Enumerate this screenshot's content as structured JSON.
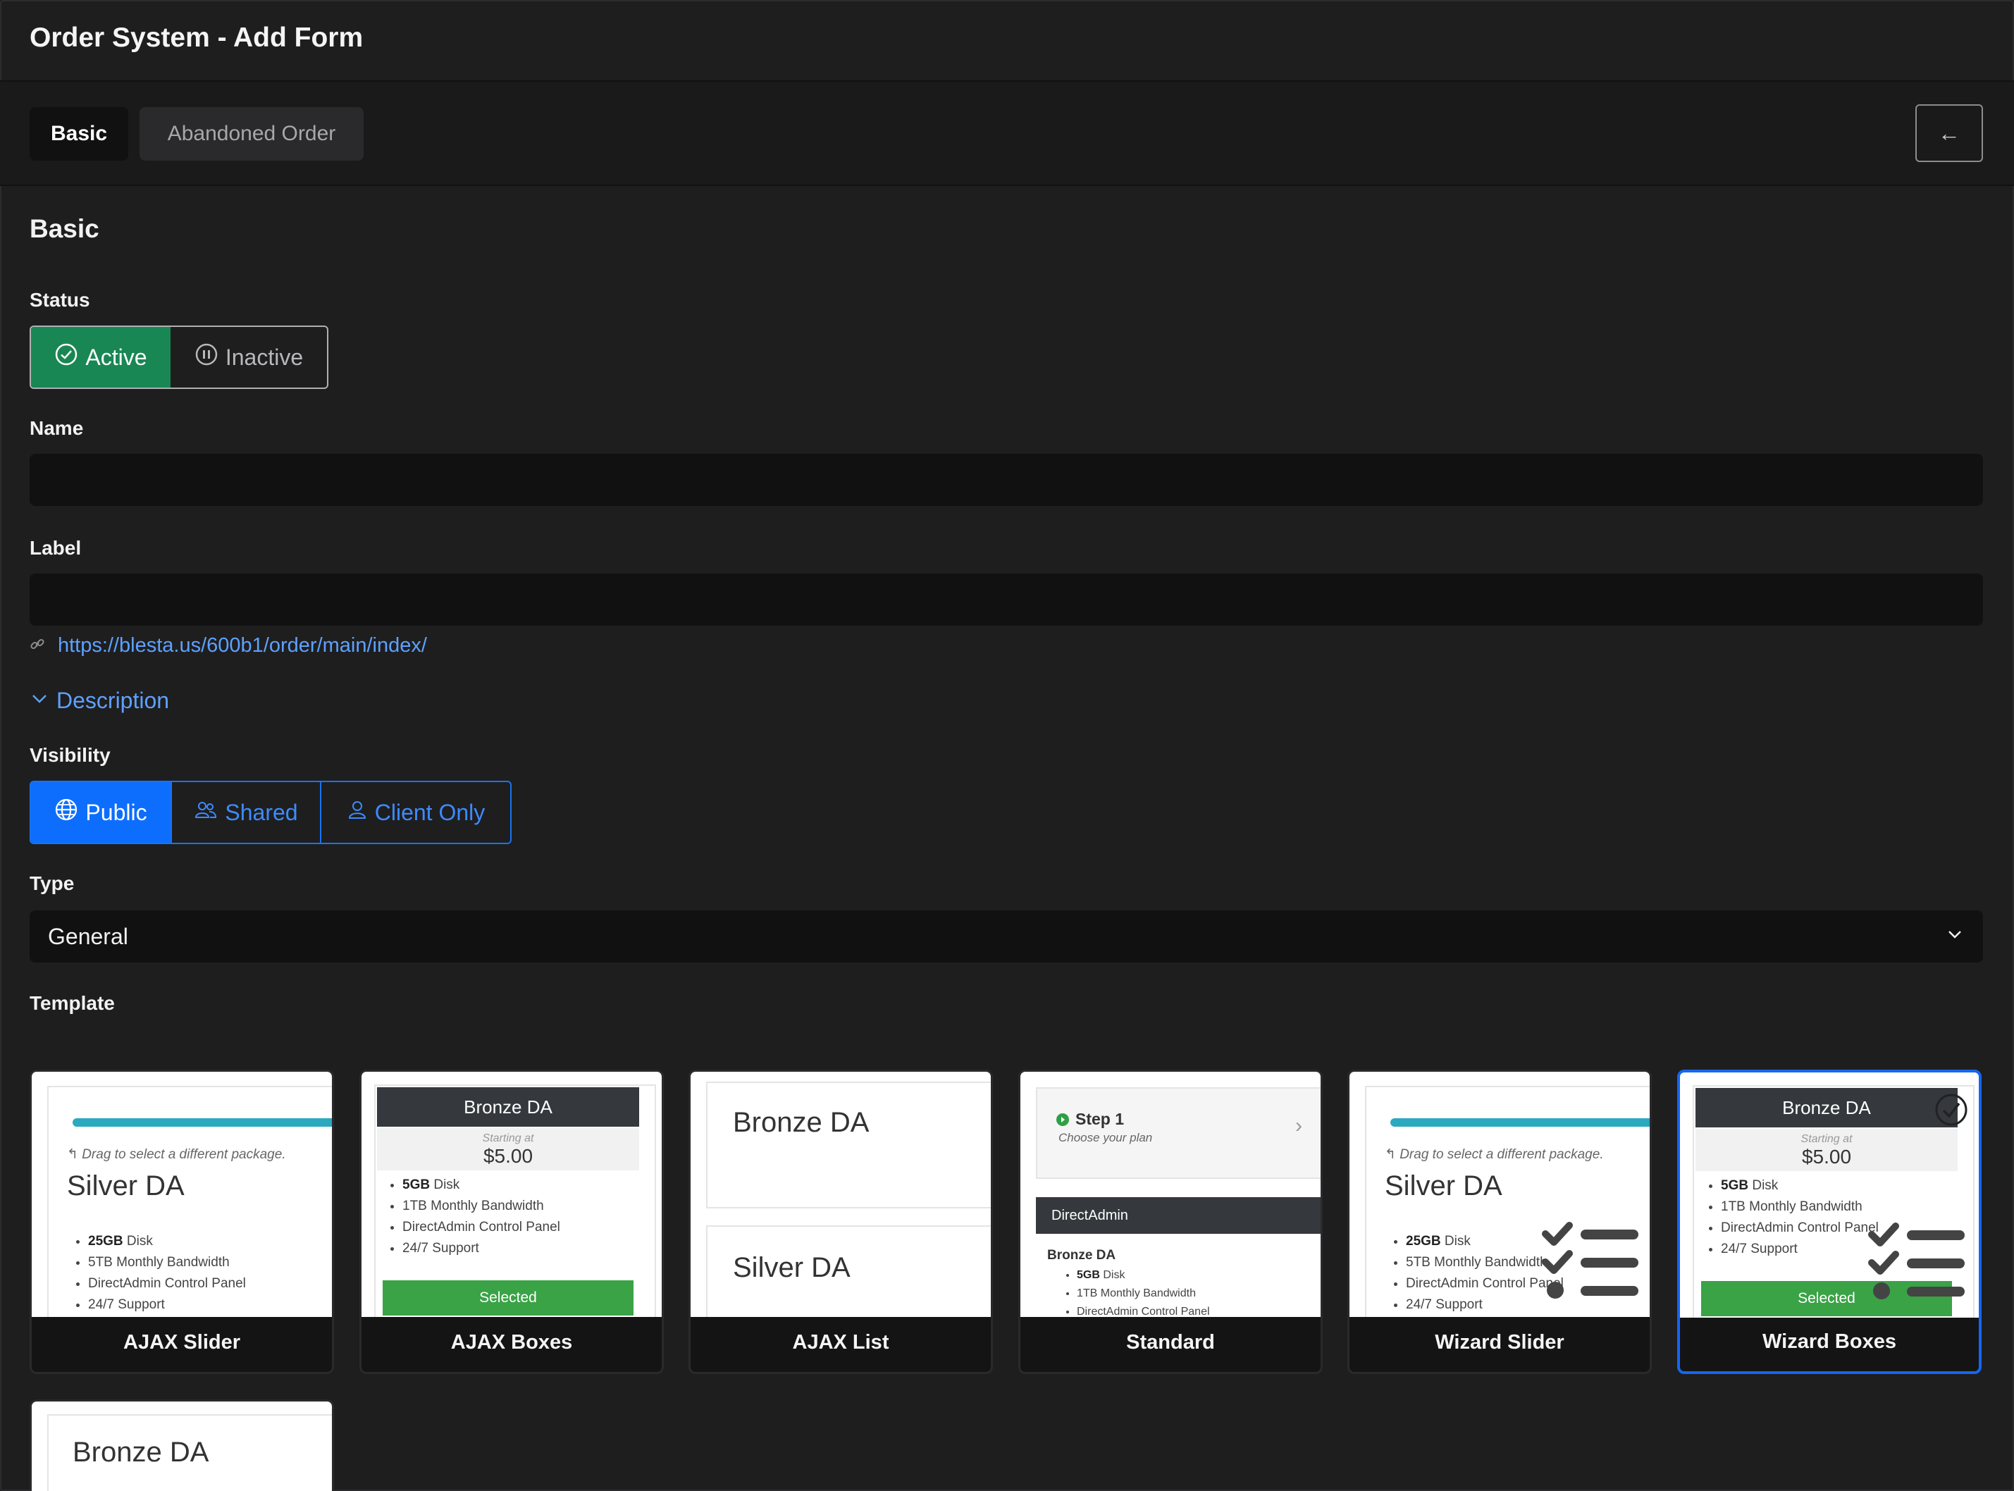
{
  "app": {
    "title": "Order System - Add Form",
    "back_icon": "←"
  },
  "tabs": [
    {
      "label": "Basic",
      "active": true
    },
    {
      "label": "Abandoned Order",
      "active": false
    }
  ],
  "section": {
    "title": "Basic"
  },
  "status": {
    "label": "Status",
    "options": [
      {
        "label": "Active",
        "icon": "check-circle-icon",
        "selected": true,
        "color": "#198754"
      },
      {
        "label": "Inactive",
        "icon": "pause-circle-icon",
        "selected": false
      }
    ]
  },
  "name": {
    "label": "Name",
    "value": ""
  },
  "label_field": {
    "label": "Label",
    "value": "",
    "url": "https://blesta.us/600b1/order/main/index/"
  },
  "description": {
    "label": "Description",
    "icon": "chevron-down-icon"
  },
  "visibility": {
    "label": "Visibility",
    "options": [
      {
        "label": "Public",
        "icon": "globe-icon",
        "selected": true,
        "color": "#0d6efd"
      },
      {
        "label": "Shared",
        "icon": "users-icon",
        "selected": false
      },
      {
        "label": "Client Only",
        "icon": "user-icon",
        "selected": false
      }
    ]
  },
  "type": {
    "label": "Type",
    "value": "General"
  },
  "template": {
    "label": "Template",
    "cards": [
      {
        "name": "AJAX Slider",
        "preview": {
          "hint": "Drag to select a different package.",
          "plan": "Silver DA",
          "features": [
            {
              "bold": "25GB",
              "text": " Disk"
            },
            {
              "bold": "",
              "text": "5TB Monthly Bandwidth"
            },
            {
              "bold": "",
              "text": "DirectAdmin Control Panel"
            },
            {
              "bold": "",
              "text": "24/7 Support"
            }
          ]
        }
      },
      {
        "name": "AJAX Boxes",
        "preview": {
          "plan": "Bronze DA",
          "price_caption": "Starting at",
          "price": "$5.00",
          "features": [
            {
              "bold": "5GB",
              "text": " Disk"
            },
            {
              "bold": "",
              "text": "1TB Monthly Bandwidth"
            },
            {
              "bold": "",
              "text": "DirectAdmin Control Panel"
            },
            {
              "bold": "",
              "text": "24/7 Support"
            }
          ],
          "button": "Selected"
        }
      },
      {
        "name": "AJAX List",
        "preview": {
          "plans": [
            "Bronze DA",
            "Silver DA"
          ]
        }
      },
      {
        "name": "Standard",
        "preview": {
          "step": "Step 1",
          "step_caption": "Choose your plan",
          "group": "DirectAdmin",
          "plan": "Bronze DA",
          "features": [
            {
              "bold": "5GB",
              "text": " Disk"
            },
            {
              "bold": "",
              "text": "1TB Monthly Bandwidth"
            },
            {
              "bold": "",
              "text": "DirectAdmin Control Panel"
            }
          ]
        }
      },
      {
        "name": "Wizard Slider",
        "preview": {
          "hint": "Drag to select a different package.",
          "plan": "Silver DA",
          "features": [
            {
              "bold": "25GB",
              "text": " Disk"
            },
            {
              "bold": "",
              "text": "5TB Monthly Bandwidth"
            },
            {
              "bold": "",
              "text": "DirectAdmin Control Panel"
            },
            {
              "bold": "",
              "text": "24/7 Support"
            }
          ]
        }
      },
      {
        "name": "Wizard Boxes",
        "selected": true,
        "preview": {
          "plan": "Bronze DA",
          "price_caption": "Starting at",
          "price": "$5.00",
          "features": [
            {
              "bold": "5GB",
              "text": " Disk"
            },
            {
              "bold": "",
              "text": "1TB Monthly Bandwidth"
            },
            {
              "bold": "",
              "text": "DirectAdmin Control Panel"
            },
            {
              "bold": "",
              "text": "24/7 Support"
            }
          ],
          "button": "Selected"
        }
      },
      {
        "name": "",
        "preview": {
          "plan": "Bronze DA"
        }
      }
    ]
  }
}
